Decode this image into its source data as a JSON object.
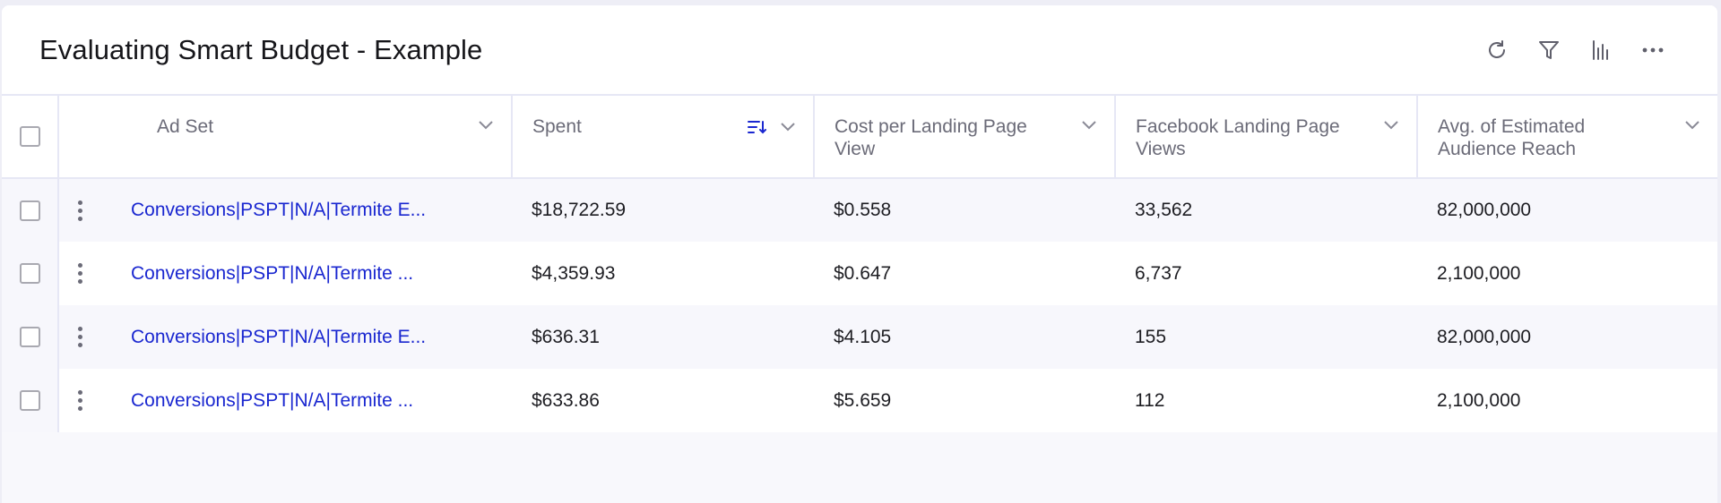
{
  "widget": {
    "title": "Evaluating Smart Budget - Example",
    "toolbar": [
      {
        "name": "refresh-icon",
        "label": "Refresh"
      },
      {
        "name": "filter-icon",
        "label": "Filter"
      },
      {
        "name": "chart-icon",
        "label": "Chart view"
      },
      {
        "name": "more-icon",
        "label": "More options"
      }
    ]
  },
  "table": {
    "columns": [
      {
        "key": "ad_set",
        "label": "Ad Set"
      },
      {
        "key": "spent",
        "label": "Spent",
        "sorted": "descending"
      },
      {
        "key": "cost_per_lpv",
        "label": "Cost per Landing Page View"
      },
      {
        "key": "fb_lpv",
        "label": "Facebook Landing Page Views"
      },
      {
        "key": "audience_reach",
        "label": "Avg. of Estimated Audience Reach"
      }
    ],
    "rows": [
      {
        "ad_set": "Conversions|PSPT|N/A|Termite E...",
        "spent": "$18,722.59",
        "cost_per_lpv": "$0.558",
        "fb_lpv": "33,562",
        "audience_reach": "82,000,000"
      },
      {
        "ad_set": "Conversions|PSPT|N/A|Termite ...",
        "spent": "$4,359.93",
        "cost_per_lpv": "$0.647",
        "fb_lpv": "6,737",
        "audience_reach": "2,100,000"
      },
      {
        "ad_set": "Conversions|PSPT|N/A|Termite E...",
        "spent": "$636.31",
        "cost_per_lpv": "$4.105",
        "fb_lpv": "155",
        "audience_reach": "82,000,000"
      },
      {
        "ad_set": "Conversions|PSPT|N/A|Termite ...",
        "spent": "$633.86",
        "cost_per_lpv": "$5.659",
        "fb_lpv": "112",
        "audience_reach": "2,100,000"
      }
    ]
  },
  "colors": {
    "link": "#1a27d0",
    "sort_accent": "#1a27d0",
    "header_text": "#6b6b78",
    "border": "#e6e7f5"
  }
}
